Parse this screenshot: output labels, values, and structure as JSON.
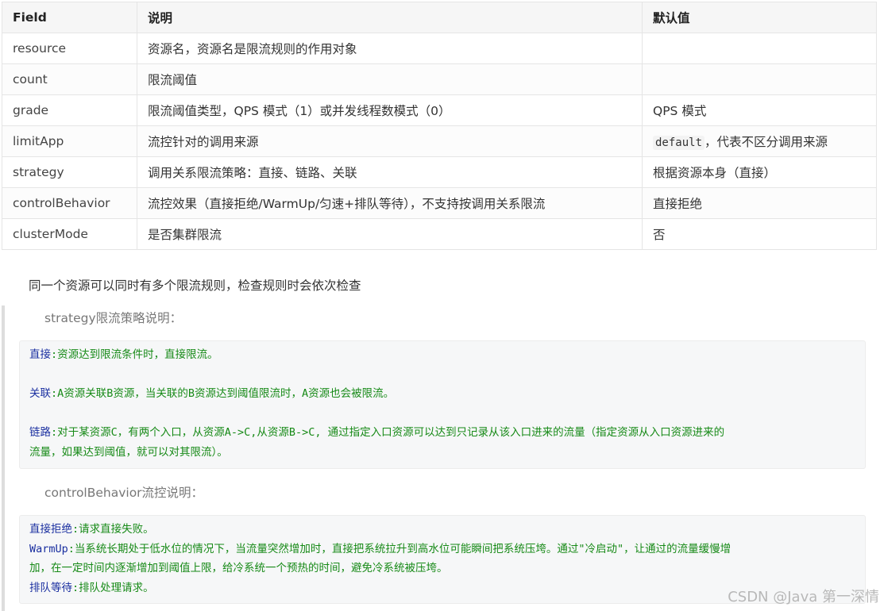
{
  "table": {
    "headers": [
      "Field",
      "说明",
      "默认值"
    ],
    "rows": [
      {
        "field": "resource",
        "desc": "资源名，资源名是限流规则的作用对象",
        "default": ""
      },
      {
        "field": "count",
        "desc": "限流阈值",
        "default": ""
      },
      {
        "field": "grade",
        "desc": "限流阈值类型，QPS 模式（1）或并发线程数模式（0）",
        "default": "QPS 模式"
      },
      {
        "field": "limitApp",
        "desc": "流控针对的调用来源",
        "default_code": "default",
        "default_text": "，代表不区分调用来源"
      },
      {
        "field": "strategy",
        "desc": "调用关系限流策略：直接、链路、关联",
        "default": "根据资源本身（直接）"
      },
      {
        "field": "controlBehavior",
        "desc": "流控效果（直接拒绝/WarmUp/匀速+排队等待），不支持按调用关系限流",
        "default": "直接拒绝"
      },
      {
        "field": "clusterMode",
        "desc": "是否集群限流",
        "default": "否"
      }
    ]
  },
  "paragraph": "同一个资源可以同时有多个限流规则，检查规则时会依次检查",
  "strategy_section": {
    "label": "strategy限流策略说明：",
    "lines": [
      {
        "key": "直接",
        "text": ":资源达到限流条件时，直接限流。"
      },
      {
        "key": "关联",
        "text": ":A资源关联B资源，当关联的B资源达到阈值限流时，A资源也会被限流。"
      },
      {
        "key": "链路",
        "text": ":对于某资源C，有两个入口，从资源A->C,从资源B->C, 通过指定入口资源可以达到只记录从该入口进来的流量（指定资源从入口资源进来的",
        "cont": "流量，如果达到阈值，就可以对其限流）。"
      }
    ]
  },
  "behavior_section": {
    "label": "controlBehavior流控说明：",
    "lines": [
      {
        "key": "直接拒绝",
        "text": ":请求直接失败。"
      },
      {
        "key": "WarmUp",
        "text": ":当系统长期处于低水位的情况下，当流量突然增加时，直接把系统拉升到高水位可能瞬间把系统压垮。通过\"冷启动\"，让通过的流量缓慢增",
        "cont": "加，在一定时间内逐渐增加到阈值上限，给冷系统一个预热的时间，避免冷系统被压垮。"
      },
      {
        "key": "排队等待",
        "text": ":排队处理请求。"
      }
    ]
  },
  "watermark": "CSDN @Java 第一深情"
}
